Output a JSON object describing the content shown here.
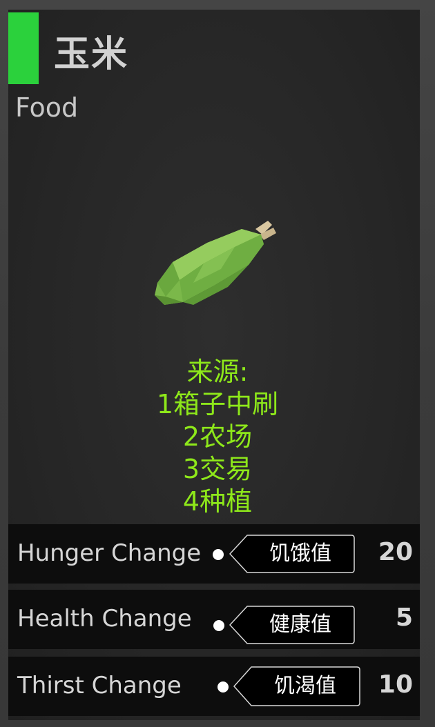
{
  "item": {
    "name": "玉米",
    "category": "Food",
    "icon": "corn-cob-icon",
    "accent_color": "#2bd13c"
  },
  "source": {
    "heading": "来源:",
    "lines": [
      "1箱子中刷",
      "2农场",
      "3交易",
      "4种植"
    ],
    "color": "#8ee81a"
  },
  "stats": [
    {
      "label": "Hunger Change",
      "tag": "饥饿值",
      "value": "20"
    },
    {
      "label": "Health Change",
      "tag": "健康值",
      "value": "5"
    },
    {
      "label": "Thirst Change",
      "tag": "饥渴值",
      "value": "10"
    }
  ]
}
